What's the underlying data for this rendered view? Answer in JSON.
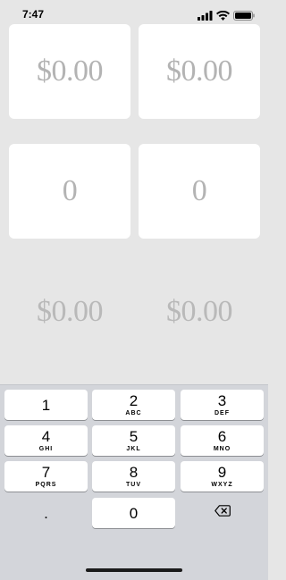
{
  "status_bar": {
    "time": "7:47",
    "icons": [
      "signal-icon",
      "wifi-icon",
      "battery-icon"
    ]
  },
  "cards": {
    "top_left": "$0.00",
    "top_right": "$0.00",
    "middle_left": "0",
    "middle_right": "0"
  },
  "totals": {
    "left": "$0.00",
    "right": "$0.00"
  },
  "keyboard": {
    "keys": [
      {
        "digit": "1",
        "letters": ""
      },
      {
        "digit": "2",
        "letters": "ABC"
      },
      {
        "digit": "3",
        "letters": "DEF"
      },
      {
        "digit": "4",
        "letters": "GHI"
      },
      {
        "digit": "5",
        "letters": "JKL"
      },
      {
        "digit": "6",
        "letters": "MNO"
      },
      {
        "digit": "7",
        "letters": "PQRS"
      },
      {
        "digit": "8",
        "letters": "TUV"
      },
      {
        "digit": "9",
        "letters": "WXYZ"
      }
    ],
    "decimal": ".",
    "zero": "0",
    "delete_icon": "delete-icon"
  }
}
